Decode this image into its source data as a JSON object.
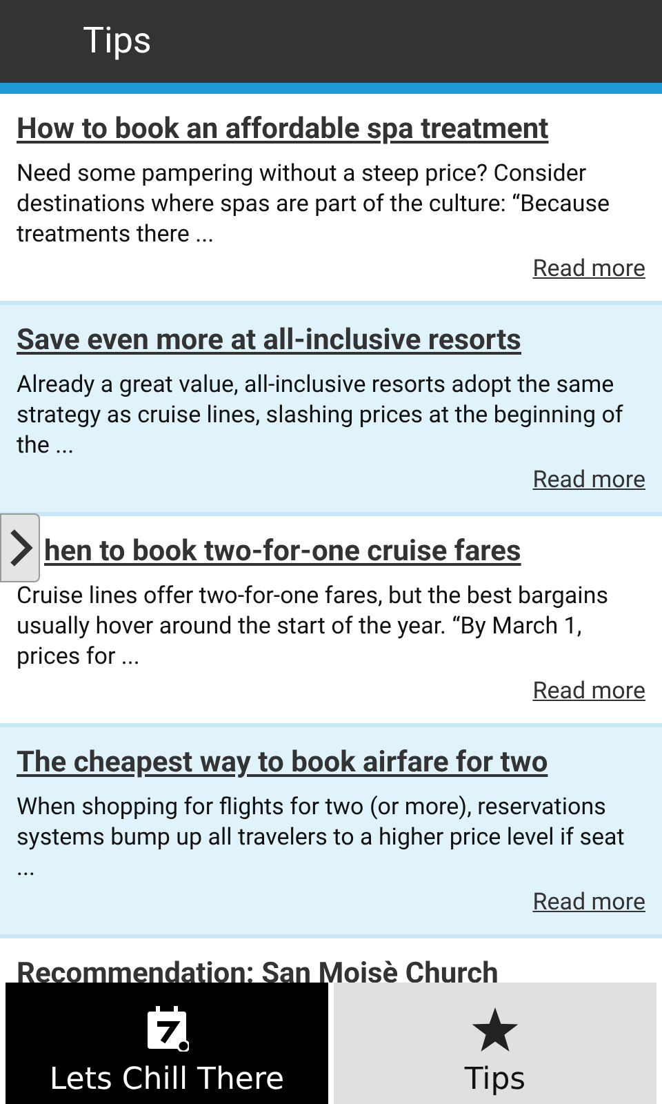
{
  "header": {
    "title": "Tips"
  },
  "tips": [
    {
      "title": "How to book an affordable spa treatment",
      "body": "Need some pampering without a steep price? Consider destinations where spas are part of the culture: “Because treatments there ...",
      "link": "Read more"
    },
    {
      "title": "Save even more at all-inclusive resorts",
      "body": "Already a great value, all-inclusive resorts adopt the same strategy as cruise lines, slashing prices at the beginning of the ...",
      "link": "Read more"
    },
    {
      "title": "hen to book two-for-one cruise fares",
      "body": "Cruise lines offer two-for-one fares, but the best bargains usually hover around the start of the year. “By March 1, prices for ...",
      "link": "Read more"
    },
    {
      "title": "The cheapest way to book airfare for two",
      "body": "When shopping for flights for two (or more), reservations systems bump up all travelers to a higher price level if seat ...",
      "link": "Read more"
    },
    {
      "title": "Recommendation: San Moisè Church"
    }
  ],
  "tabs": [
    {
      "label": "Lets Chill There",
      "kind": "calendar",
      "selected": false
    },
    {
      "label": "Tips",
      "kind": "star",
      "selected": true
    }
  ]
}
